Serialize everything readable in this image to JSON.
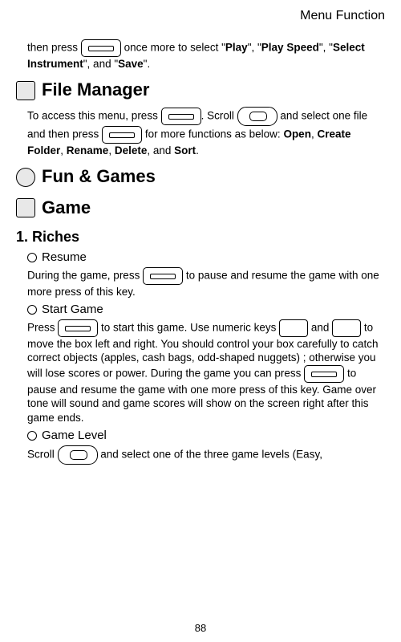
{
  "header": "Menu Function",
  "top_paragraph": {
    "t1": "then press ",
    "t2": " once more to select \"",
    "b1": "Play",
    "t3": "\", \"",
    "b2": "Play Speed",
    "t4": "\", \"",
    "b3": "Select Instrument",
    "t5": "\", and \"",
    "b4": "Save",
    "t6": "\"."
  },
  "file_manager": {
    "title": "File Manager",
    "p1a": "To access this menu, press ",
    "p1b": ". Scroll ",
    "p1c": " and select one file and then press ",
    "p1d": " for more functions as below: ",
    "b1": "Open",
    "sep": ", ",
    "b2": "Create Folder",
    "b3": "Rename",
    "b4": "Delete",
    "and": ", and ",
    "b5": "Sort",
    "end": "."
  },
  "fun_games": {
    "title": "Fun & Games"
  },
  "game": {
    "title": "Game"
  },
  "riches": {
    "title": "1. Riches"
  },
  "resume": {
    "title": "Resume",
    "p1a": "During the game, press ",
    "p1b": " to pause and resume the game with one more press of this key."
  },
  "start_game": {
    "title": "Start Game",
    "p1a": "Press ",
    "p1b": " to start this game. Use numeric keys ",
    "p1c": " and ",
    "p1d": " to move the box left and right. You should control your box carefully to catch correct objects (apples, cash bags, odd-shaped nuggets) ; otherwise you will lose scores or power. During the game you can press ",
    "p1e": " to pause and resume the game with one more press of this key. Game over tone will sound and game scores will show on the screen right after this game ends."
  },
  "game_level": {
    "title": "Game Level",
    "p1a": "Scroll ",
    "p1b": " and select one of the three game levels (Easy,"
  },
  "page_number": "88"
}
